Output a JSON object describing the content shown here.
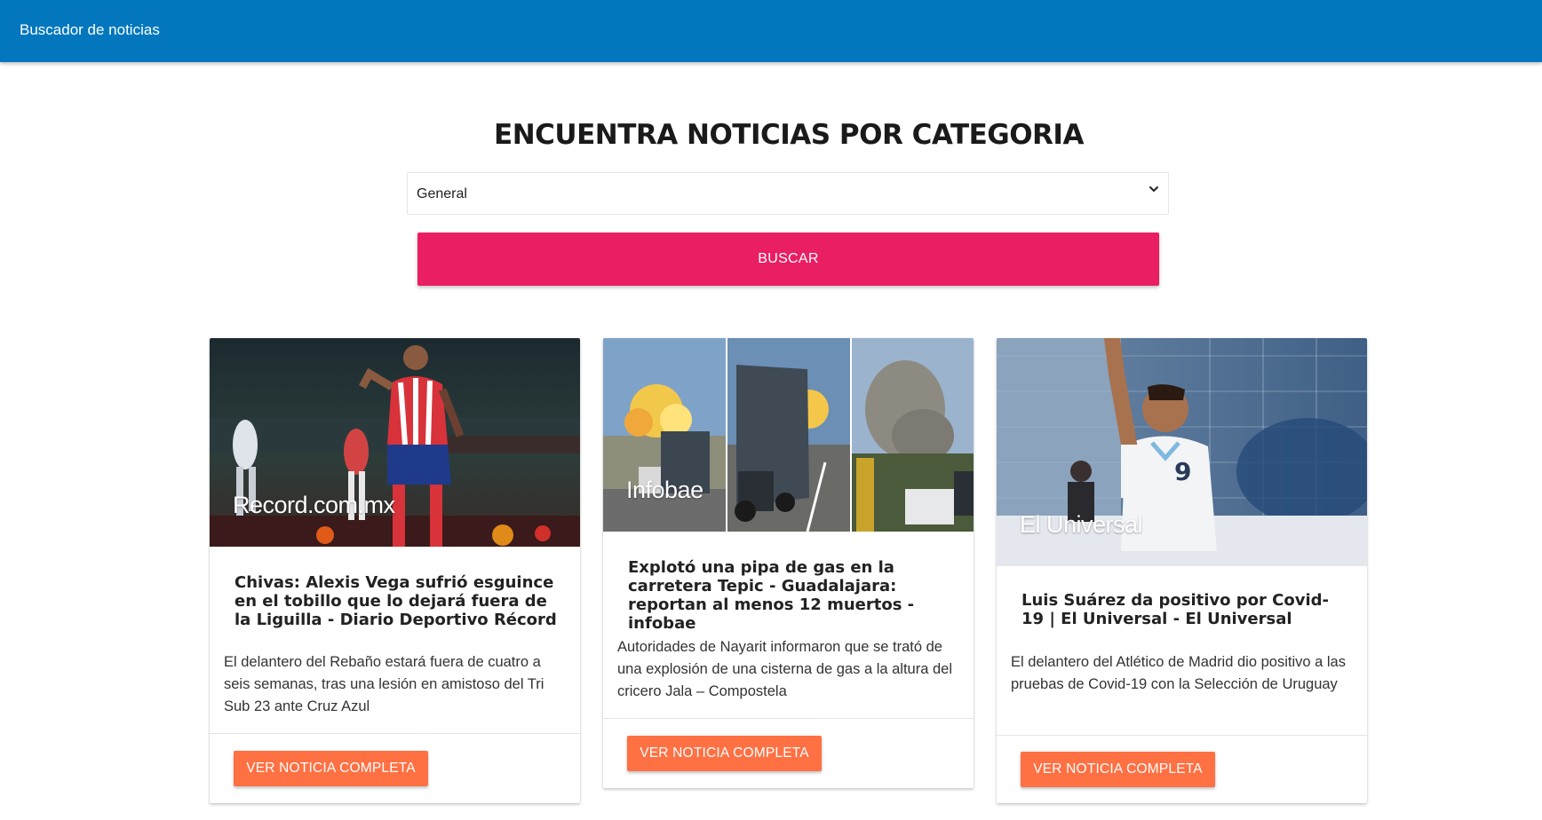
{
  "navbar": {
    "brand": "Buscador de noticias"
  },
  "heading": "ENCUENTRA NOTICIAS POR CATEGORIA",
  "category_select": {
    "selected": "General"
  },
  "search_button": "BUSCAR",
  "colors": {
    "navbar": "#0277bd",
    "search_button": "#e91e63",
    "card_button": "#ff7043"
  },
  "icons": {
    "select_arrow": "chevron-down-icon"
  },
  "cards": [
    {
      "source": "Record.com.mx",
      "title": "Chivas: Alexis Vega sufrió esguince en el tobillo que lo dejará fuera de la Liguilla - Diario Deportivo Récord",
      "description": "El delantero del Rebaño estará fuera de cuatro a seis semanas, tras una lesión en amistoso del Tri Sub 23 ante Cruz Azul",
      "button": "VER NOTICIA COMPLETA"
    },
    {
      "source": "Infobae",
      "title": "Explotó una pipa de gas en la carretera Tepic - Guadalajara: reportan al menos 12 muertos - infobae",
      "description": "Autoridades de Nayarit informaron que se trató de una explosión de una cisterna de gas a la altura del cricero Jala – Compostela",
      "button": "VER NOTICIA COMPLETA"
    },
    {
      "source": "El Universal",
      "title": "Luis Suárez da positivo por Covid-19 | El Universal - El Universal",
      "description": "El delantero del Atlético de Madrid dio positivo a las pruebas de Covid-19 con la Selección de Uruguay",
      "button": "VER NOTICIA COMPLETA"
    }
  ]
}
